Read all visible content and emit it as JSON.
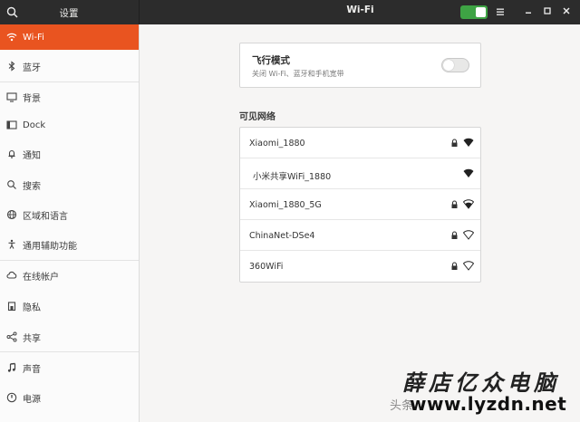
{
  "header": {
    "sidebar_title": "设置",
    "title": "Wi-Fi",
    "wifi_switch_on": true,
    "switch_color": "#3ea344"
  },
  "sidebar": {
    "accent": "#e95420",
    "items": [
      {
        "label": "Wi-Fi",
        "icon": "wifi-icon",
        "active": true
      },
      {
        "label": "蓝牙",
        "icon": "bluetooth-icon"
      },
      {
        "label": "背景",
        "icon": "background-icon"
      },
      {
        "label": "Dock",
        "icon": "dock-icon"
      },
      {
        "label": "通知",
        "icon": "bell-icon"
      },
      {
        "label": "搜索",
        "icon": "search-icon"
      },
      {
        "label": "区域和语言",
        "icon": "globe-icon"
      },
      {
        "label": "通用辅助功能",
        "icon": "accessibility-icon"
      },
      {
        "label": "在线帐户",
        "icon": "cloud-icon"
      },
      {
        "label": "隐私",
        "icon": "privacy-icon"
      },
      {
        "label": "共享",
        "icon": "share-icon"
      },
      {
        "label": "声音",
        "icon": "music-note-icon"
      },
      {
        "label": "电源",
        "icon": "power-icon"
      }
    ]
  },
  "airplane": {
    "title": "飞行模式",
    "subtitle": "关闭 Wi-Fi、蓝牙和手机宽带",
    "enabled": false
  },
  "networks": {
    "section_title": "可见网络",
    "items": [
      {
        "name": "Xiaomi_1880",
        "locked": true,
        "signal": "full"
      },
      {
        "name": "小米共享WiFi_1880",
        "locked": false,
        "signal": "full"
      },
      {
        "name": "Xiaomi_1880_5G",
        "locked": true,
        "signal": "good"
      },
      {
        "name": "ChinaNet-DSe4",
        "locked": true,
        "signal": "weak"
      },
      {
        "name": "360WiFi",
        "locked": true,
        "signal": "weak"
      }
    ]
  },
  "watermark": {
    "calligraphy": "薛店亿众电脑",
    "prefix": "头条",
    "url": "www.lyzdn.net"
  }
}
